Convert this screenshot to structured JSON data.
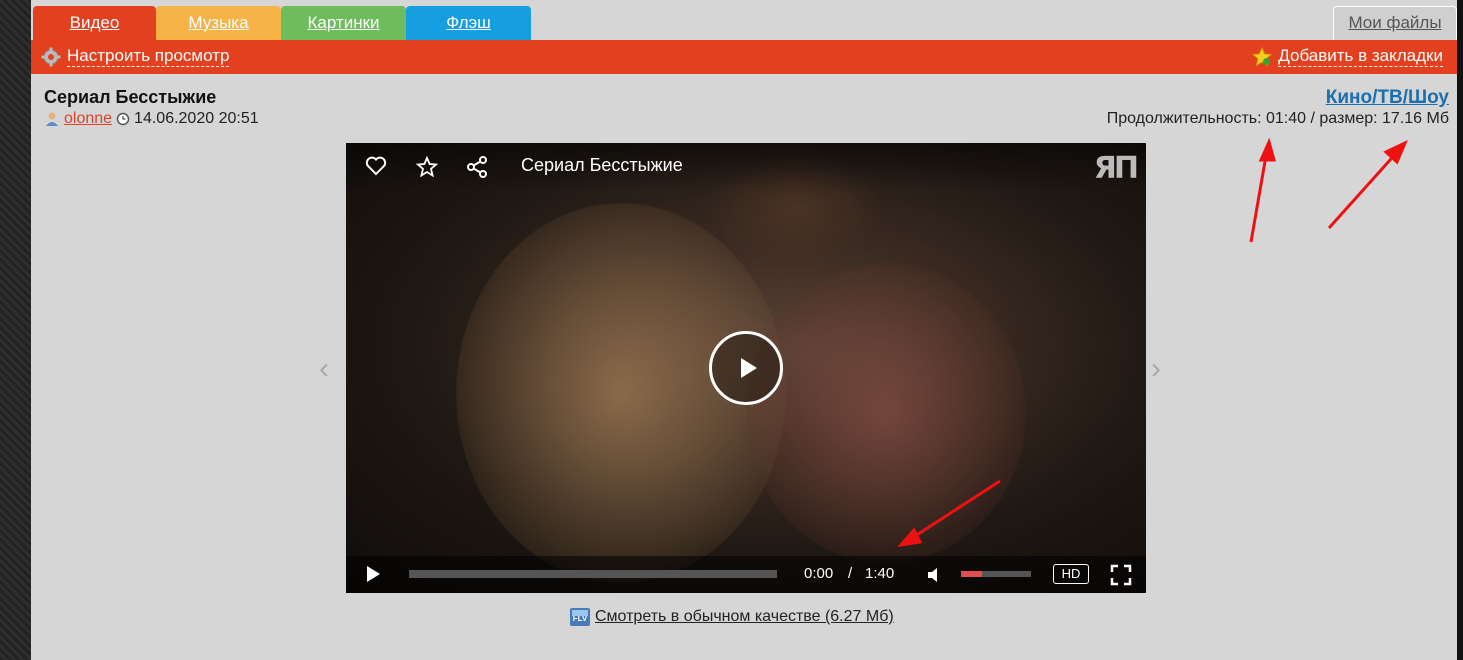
{
  "tabs": {
    "video": "Видео",
    "music": "Музыка",
    "pictures": "Картинки",
    "flash": "Флэш",
    "my_files": "Мои файлы"
  },
  "toolbar": {
    "settings_label": "Настроить просмотр",
    "bookmark_label": "Добавить в закладки"
  },
  "file": {
    "title": "Сериал Бесстыжие",
    "user": "olonne",
    "datetime": "14.06.2020 20:51",
    "category": "Кино/ТВ/Шоу",
    "info": "Продолжительность: 01:40 / размер: 17.16 Мб"
  },
  "player": {
    "title": "Сериал Бесстыжие",
    "logo": "ЯП",
    "current_time": "0:00",
    "separator": "/",
    "duration": "1:40",
    "quality": "HD",
    "volume_fraction": 0.3,
    "progress_fraction": 0
  },
  "bottom": {
    "link_label": "Смотреть в обычном качестве (6.27 Мб)",
    "format_badge": "FLV"
  },
  "colors": {
    "brand_red": "#e3401f",
    "music": "#f6b347",
    "pictures": "#6dbd5c",
    "flash": "#169fe0",
    "link_blue": "#1a6faf"
  },
  "icons": {
    "settings": "gear-icon",
    "bookmark": "star-icon",
    "user": "user-icon",
    "clock": "clock-icon",
    "like": "heart-icon",
    "favorite": "star-outline-icon",
    "share": "share-icon",
    "play": "play-icon",
    "volume": "volume-icon",
    "fullscreen": "fullscreen-icon"
  }
}
